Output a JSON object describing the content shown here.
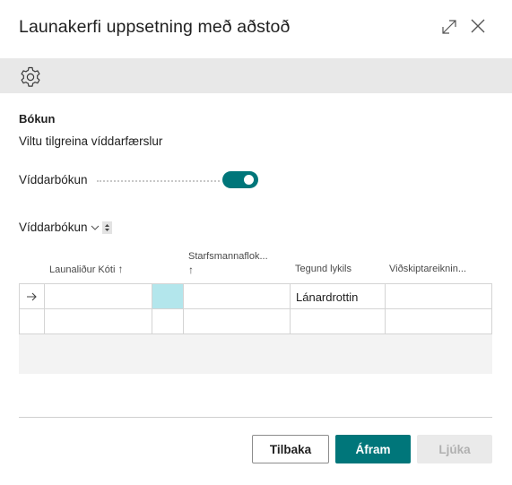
{
  "dialog": {
    "title": "Launakerfi uppsetning með aðstoð"
  },
  "section": {
    "heading": "Bókun",
    "instruction": "Viltu tilgreina víddarfærslur"
  },
  "field": {
    "label": "Víddarbókun",
    "toggle_on": true
  },
  "part": {
    "title": "Víddarbókun"
  },
  "grid": {
    "columns": [
      {
        "label": "Launaliður Kóti",
        "sorted": "↑"
      },
      {
        "label": "Starfsmannaflok...",
        "sorted": "↑"
      },
      {
        "label": "Tegund lykils"
      },
      {
        "label": "Viðskiptareiknin..."
      }
    ],
    "rows": [
      {
        "launalidur": "",
        "starfsmannaflokkur": "",
        "tegund_lykils": "Lánardrottin",
        "vidskiptareikningur": ""
      },
      {
        "launalidur": "",
        "starfsmannaflokkur": "",
        "tegund_lykils": "",
        "vidskiptareikningur": ""
      }
    ]
  },
  "buttons": {
    "back": "Tilbaka",
    "next": "Áfram",
    "finish": "Ljúka"
  },
  "colors": {
    "accent": "#00767a",
    "selected_cell": "#b3e6ec",
    "actionbar": "#e8e8e8"
  },
  "icons": [
    "expand-icon",
    "close-icon",
    "gear-icon",
    "chevron-down-icon",
    "sort-icon",
    "row-arrow-icon",
    "sort-arrow-up-icon"
  ]
}
